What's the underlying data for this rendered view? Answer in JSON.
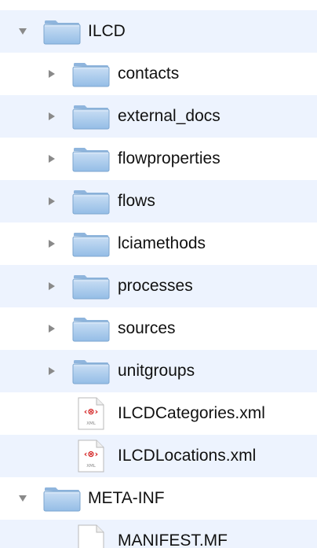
{
  "tree": {
    "items": [
      {
        "label": "ILCD",
        "kind": "folder",
        "expanded": true
      },
      {
        "label": "contacts",
        "kind": "folder",
        "expanded": false
      },
      {
        "label": "external_docs",
        "kind": "folder",
        "expanded": false
      },
      {
        "label": "flowproperties",
        "kind": "folder",
        "expanded": false
      },
      {
        "label": "flows",
        "kind": "folder",
        "expanded": false
      },
      {
        "label": "lciamethods",
        "kind": "folder",
        "expanded": false
      },
      {
        "label": "processes",
        "kind": "folder",
        "expanded": false
      },
      {
        "label": "sources",
        "kind": "folder",
        "expanded": false
      },
      {
        "label": "unitgroups",
        "kind": "folder",
        "expanded": false
      },
      {
        "label": "ILCDCategories.xml",
        "kind": "xml-file"
      },
      {
        "label": "ILCDLocations.xml",
        "kind": "xml-file"
      },
      {
        "label": "META-INF",
        "kind": "folder",
        "expanded": true
      },
      {
        "label": "MANIFEST.MF",
        "kind": "plain-file"
      }
    ]
  },
  "icons": {
    "folder": "folder-icon",
    "xml_file": "xml-file-icon",
    "plain_file": "document-icon",
    "xml_badge_text": "XML"
  },
  "colors": {
    "row_alt": "#edf3fe",
    "folder_blue": "#a9ccec",
    "disclosure": "#8a8a8a",
    "xml_red": "#d32020"
  }
}
